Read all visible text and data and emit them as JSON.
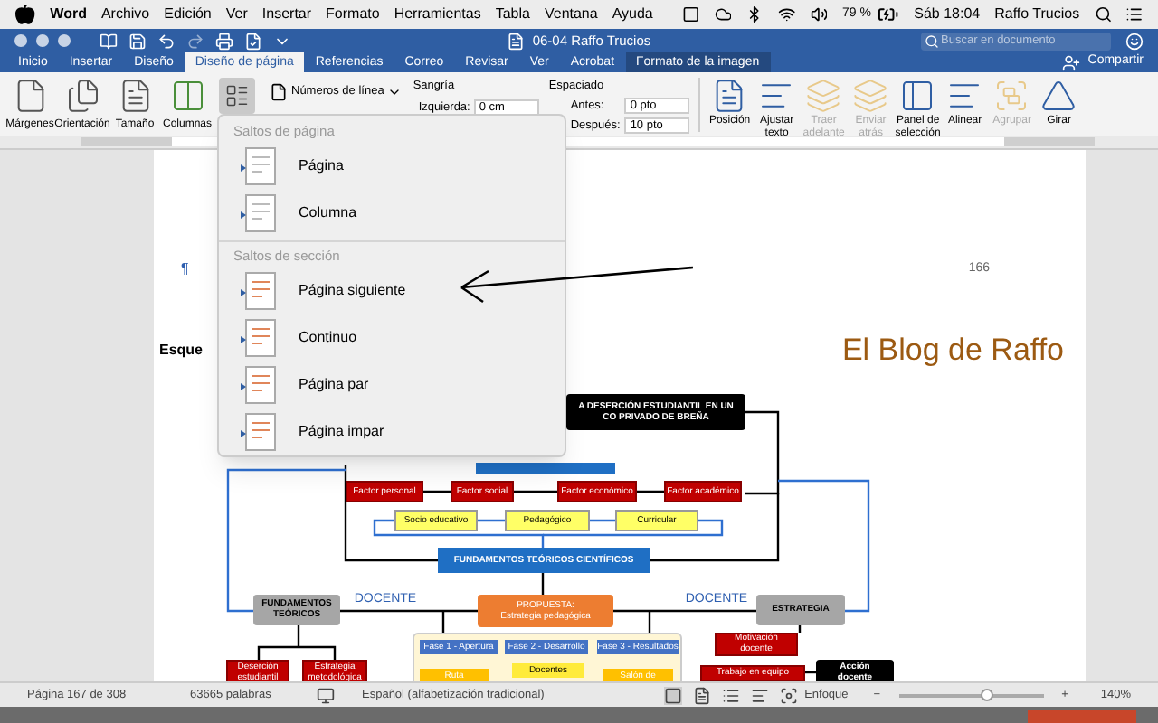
{
  "menubar": {
    "app": "Word",
    "items": [
      "Archivo",
      "Edición",
      "Ver",
      "Insertar",
      "Formato",
      "Herramientas",
      "Tabla",
      "Ventana",
      "Ayuda"
    ],
    "battery": "79 %",
    "clock": "Sáb 18:04",
    "user": "Raffo Trucios"
  },
  "window": {
    "title": "06-04 Raffo Trucios",
    "search": {
      "placeholder": "Buscar en documento"
    }
  },
  "tabs": [
    {
      "label": "Inicio",
      "selected": false,
      "kind": "standard"
    },
    {
      "label": "Insertar",
      "selected": false,
      "kind": "standard"
    },
    {
      "label": "Diseño",
      "selected": false,
      "kind": "standard"
    },
    {
      "label": "Diseño de página",
      "selected": true,
      "kind": "standard"
    },
    {
      "label": "Referencias",
      "selected": false,
      "kind": "standard"
    },
    {
      "label": "Correo",
      "selected": false,
      "kind": "standard"
    },
    {
      "label": "Revisar",
      "selected": false,
      "kind": "standard"
    },
    {
      "label": "Ver",
      "selected": false,
      "kind": "standard"
    },
    {
      "label": "Acrobat",
      "selected": false,
      "kind": "standard"
    },
    {
      "label": "Formato de la imagen",
      "selected": false,
      "kind": "contextual"
    }
  ],
  "share": "Compartir",
  "ribbon": {
    "page_buttons": [
      {
        "label": "Márgenes"
      },
      {
        "label": "Orientación"
      },
      {
        "label": "Tamaño"
      },
      {
        "label": "Columnas"
      }
    ],
    "breaks_pressed": true,
    "line_numbers": "Números de línea",
    "indent": {
      "title": "Sangría",
      "left_label": "Izquierda:",
      "left_value": "0 cm"
    },
    "spacing": {
      "title": "Espaciado",
      "before_label": "Antes:",
      "before_value": "0 pto",
      "after_label": "Después:",
      "after_value": "10 pto"
    },
    "arrange": [
      {
        "label": "Posición",
        "disabled": false
      },
      {
        "label": "Ajustar texto",
        "disabled": false
      },
      {
        "label": "Traer adelante",
        "disabled": true
      },
      {
        "label": "Enviar atrás",
        "disabled": true
      },
      {
        "label": "Panel de selección",
        "disabled": false
      },
      {
        "label": "Alinear",
        "disabled": false
      },
      {
        "label": "Agrupar",
        "disabled": true
      },
      {
        "label": "Girar",
        "disabled": false
      }
    ]
  },
  "breaks_menu": [
    {
      "title": "Saltos de página",
      "items": [
        {
          "label": "Página"
        },
        {
          "label": "Columna"
        }
      ]
    },
    {
      "title": "Saltos de sección",
      "items": [
        {
          "label": "Página siguiente"
        },
        {
          "label": "Continuo"
        },
        {
          "label": "Página par"
        },
        {
          "label": "Página impar"
        }
      ]
    }
  ],
  "document": {
    "mark": "¶",
    "page_number": "166",
    "heading": "Esque",
    "blog": "El Blog de Raffo",
    "diagram": [
      {
        "kind": "title",
        "lines": [
          "A DESERCIÓN ESTUDIANTIL EN UN",
          "CO PRIVADO DE BREÑA"
        ]
      },
      {
        "kind": "factor",
        "lines": [
          "Factor personal"
        ]
      },
      {
        "kind": "factor",
        "lines": [
          "Factor social"
        ]
      },
      {
        "kind": "factor",
        "lines": [
          "Factor económico"
        ]
      },
      {
        "kind": "factor",
        "lines": [
          "Factor académico"
        ]
      },
      {
        "kind": "dimension",
        "lines": [
          "Socio educativo"
        ]
      },
      {
        "kind": "dimension",
        "lines": [
          "Pedagógico"
        ]
      },
      {
        "kind": "dimension",
        "lines": [
          "Curricular"
        ]
      },
      {
        "kind": "core",
        "lines": [
          "FUNDAMENTOS TEÓRICOS CIENTÍFICOS"
        ]
      },
      {
        "kind": "branch",
        "lines": [
          "FUNDAMENTOS",
          "TEÓRICOS"
        ]
      },
      {
        "kind": "label",
        "lines": [
          "DOCENTE"
        ]
      },
      {
        "kind": "proposal",
        "lines": [
          "PROPUESTA:",
          "Estrategia pedagógica"
        ]
      },
      {
        "kind": "label",
        "lines": [
          "DOCENTE"
        ]
      },
      {
        "kind": "branch",
        "lines": [
          "ESTRATEGIA"
        ]
      },
      {
        "kind": "phase",
        "lines": [
          "Fase 1 - Apertura"
        ]
      },
      {
        "kind": "phase",
        "lines": [
          "Fase 2 - Desarrollo"
        ]
      },
      {
        "kind": "phase",
        "lines": [
          "Fase 3 - Resultados"
        ]
      },
      {
        "kind": "factor",
        "lines": [
          "Motivación",
          "docente"
        ]
      },
      {
        "kind": "factor",
        "lines": [
          "Deserción",
          "estudiantil"
        ]
      },
      {
        "kind": "factor",
        "lines": [
          "Estrategia",
          "metodológica"
        ]
      },
      {
        "kind": "route",
        "lines": [
          "Ruta"
        ]
      },
      {
        "kind": "arrow",
        "lines": [
          "Docentes"
        ]
      },
      {
        "kind": "route",
        "lines": [
          "Salón de"
        ]
      },
      {
        "kind": "factor",
        "lines": [
          "Trabajo en equipo"
        ]
      },
      {
        "kind": "title",
        "lines": [
          "Acción",
          "docente"
        ]
      }
    ]
  },
  "status_bar": {
    "page": "Página 167 de 308",
    "words": "63665 palabras",
    "language": "Español (alfabetización tradicional)",
    "focus": "Enfoque",
    "zoom_minus": "−",
    "zoom_plus": "+",
    "zoom": "140%",
    "zoom_slider": {
      "level": 0.6
    }
  }
}
